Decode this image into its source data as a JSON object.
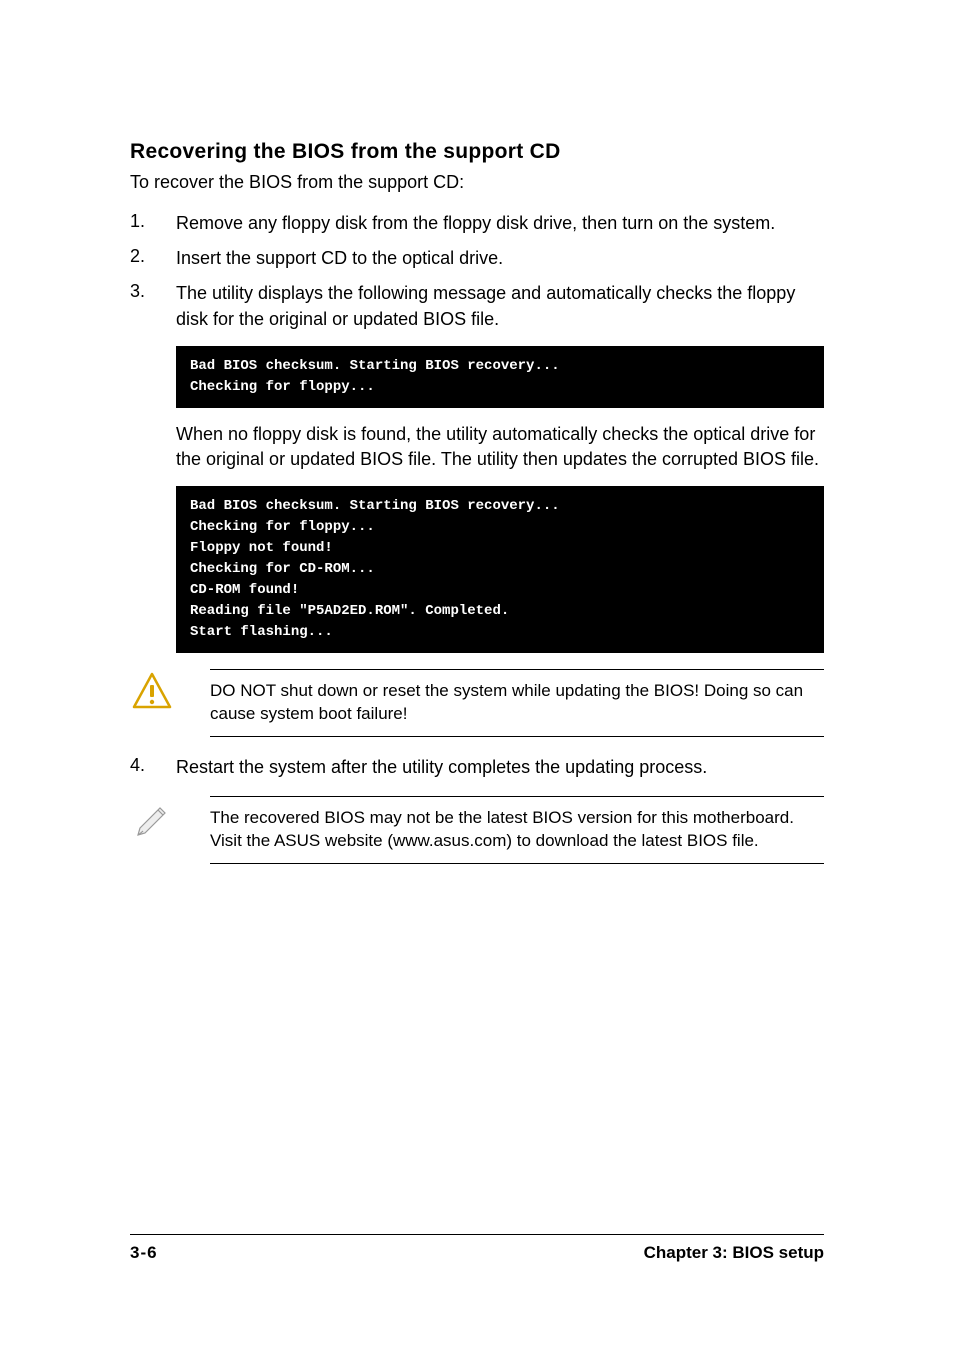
{
  "subheading": "Recovering the BIOS from the support CD",
  "intro": "To recover the BIOS from the support CD:",
  "steps": {
    "s1": {
      "num": "1.",
      "text": "Remove any floppy disk from the floppy disk drive, then turn on the system."
    },
    "s2": {
      "num": "2.",
      "text": "Insert the support CD to the optical drive."
    },
    "s3": {
      "num": "3.",
      "text": "The utility displays the following message and automatically checks the floppy disk for the original or updated BIOS file."
    },
    "s4": {
      "num": "4.",
      "text": "Restart the system after the utility completes the updating process."
    }
  },
  "code1": "Bad BIOS checksum. Starting BIOS recovery...\nChecking for floppy...",
  "midparagraph": "When no floppy disk is found, the utility automatically checks the optical drive for the original or updated BIOS file. The utility then updates the corrupted BIOS file.",
  "code2": "Bad BIOS checksum. Starting BIOS recovery...\nChecking for floppy...\nFloppy not found!\nChecking for CD-ROM...\nCD-ROM found!\nReading file \"P5AD2ED.ROM\". Completed.\nStart flashing...",
  "warning": "DO NOT shut down or reset the system while updating the BIOS! Doing so can cause system boot failure!",
  "note": "The recovered BIOS may not be the latest BIOS version for this motherboard. Visit the ASUS website (www.asus.com) to download the latest BIOS file.",
  "footer": {
    "left": "3-6",
    "right": "Chapter 3: BIOS setup"
  }
}
